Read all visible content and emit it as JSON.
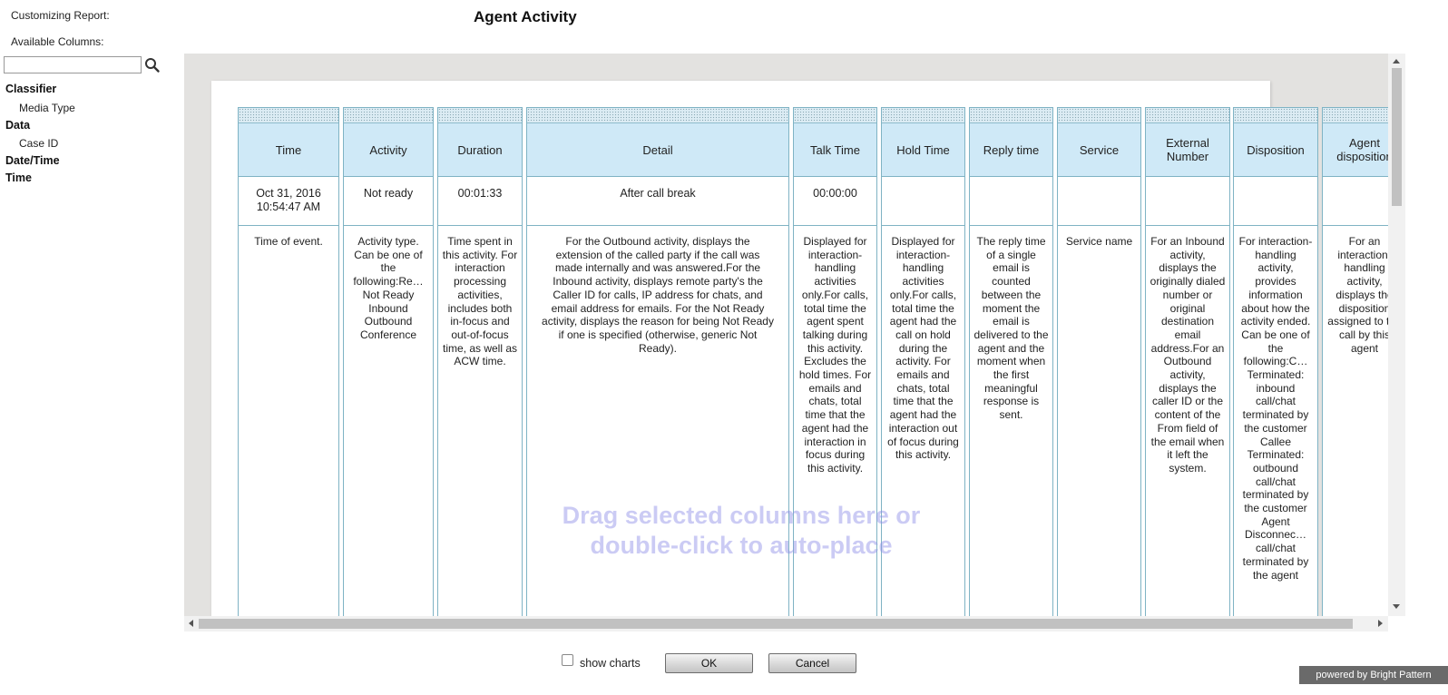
{
  "header": {
    "customizing_label": "Customizing Report:",
    "report_title": "Agent Activity",
    "available_columns_label": "Available Columns:"
  },
  "search": {
    "value": "",
    "placeholder": ""
  },
  "tree": {
    "classifier": {
      "label": "Classifier",
      "items": [
        "Media Type"
      ]
    },
    "data": {
      "label": "Data",
      "items": [
        "Case ID"
      ]
    },
    "datetime": {
      "label": "Date/Time"
    },
    "time": {
      "label": "Time"
    }
  },
  "columns": [
    {
      "header": "Time",
      "sample": "Oct 31, 2016 10:54:47 AM",
      "description": "Time of event."
    },
    {
      "header": "Activity",
      "sample": "Not ready",
      "description": "Activity type. Can be one of the following:Re… Not Ready Inbound Outbound Conference"
    },
    {
      "header": "Duration",
      "sample": "00:01:33",
      "description": "Time spent in this activity. For interaction processing activities, includes both in-focus and out-of-focus time, as well as ACW time."
    },
    {
      "header": "Detail",
      "sample": "After call break",
      "description": "For the Outbound activity, displays the extension of the called party if the call was made internally and was answered.For the Inbound activity, displays remote party's the Caller ID for calls, IP address for chats, and email address for emails. For the Not Ready activity, displays the reason for being Not Ready if one is specified (otherwise, generic Not Ready)."
    },
    {
      "header": "Talk Time",
      "sample": "00:00:00",
      "description": "Displayed for interaction-handling activities only.For calls, total time the agent spent talking during this activity. Excludes the hold times. For emails and chats, total time that the agent had the interaction in focus during this activity."
    },
    {
      "header": "Hold Time",
      "sample": "",
      "description": "Displayed for interaction-handling activities only.For calls, total time the agent had the call on hold during the activity. For emails and chats, total time that the agent had the interaction out of focus during this activity."
    },
    {
      "header": "Reply time",
      "sample": "",
      "description": "The reply time of a single email is counted between the moment the email is delivered to the agent and the moment when the first meaningful response is sent."
    },
    {
      "header": "Service",
      "sample": "",
      "description": "Service name"
    },
    {
      "header": "External Number",
      "sample": "",
      "description": "For an Inbound activity, displays the originally dialed number or original destination email address.For an Outbound activity, displays the caller ID or the content of the From field of the email when it left the system."
    },
    {
      "header": "Disposition",
      "sample": "",
      "description": "For interaction-handling activity, provides information about how the activity ended. Can be one of the following:C… Terminated: inbound call/chat terminated by the customer Callee Terminated: outbound call/chat terminated by the customer Agent Disconnec… call/chat terminated by the agent"
    },
    {
      "header": "Agent disposition",
      "sample": "",
      "description": "For an interaction-handling activity, displays the disposition assigned to the call by this agent"
    }
  ],
  "drop_hint": "Drag selected columns here or double-click to auto-place",
  "footer": {
    "show_charts_label": "show charts",
    "show_charts_checked": false,
    "ok_label": "OK",
    "cancel_label": "Cancel",
    "powered_by": "powered by Bright Pattern"
  }
}
